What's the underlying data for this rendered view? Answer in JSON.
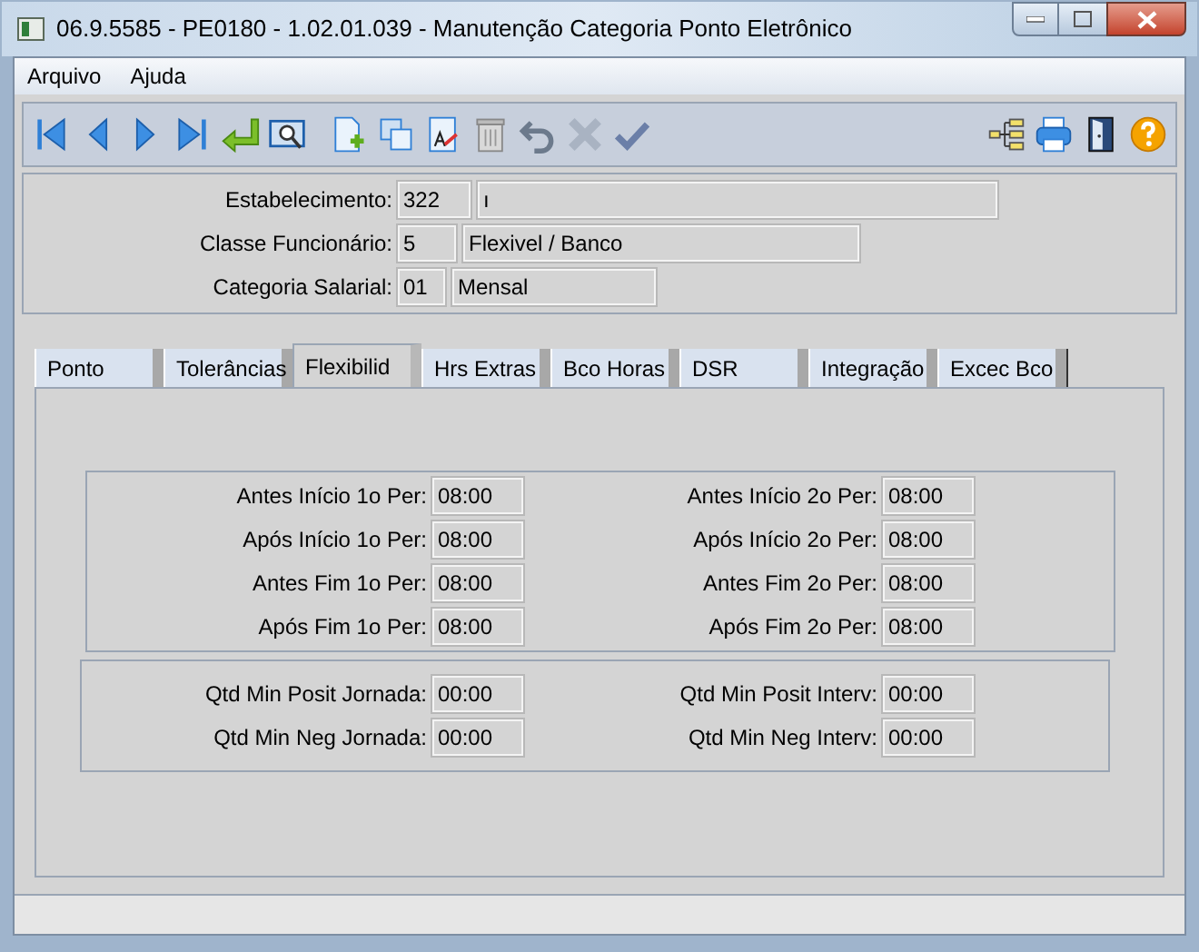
{
  "window": {
    "title": "06.9.5585 - PE0180 - 1.02.01.039 - Manutenção Categoria Ponto Eletrônico"
  },
  "menu": [
    "Arquivo",
    "Ajuda"
  ],
  "header": [
    {
      "label": "Estabelecimento:",
      "code": "322",
      "description": "ı"
    },
    {
      "label": "Classe Funcionário:",
      "code": "5",
      "description": "Flexivel / Banco"
    },
    {
      "label": "Categoria Salarial:",
      "code": "01",
      "description": "Mensal"
    }
  ],
  "tabs": [
    {
      "label": "Ponto",
      "selected": false
    },
    {
      "label": "Tolerâncias",
      "selected": false
    },
    {
      "label": "Flexibilid",
      "selected": true
    },
    {
      "label": "Hrs Extras",
      "selected": false
    },
    {
      "label": "Bco Horas",
      "selected": false
    },
    {
      "label": "DSR",
      "selected": false
    },
    {
      "label": "Integração",
      "selected": false
    },
    {
      "label": "Excec Bco",
      "selected": false
    }
  ],
  "groups": [
    {
      "rows": [
        {
          "left": {
            "label": "Antes Início 1o Per:",
            "value": "08:00"
          },
          "right": {
            "label": "Antes Início 2o Per:",
            "value": "08:00"
          }
        },
        {
          "left": {
            "label": "Após Início 1o Per:",
            "value": "08:00"
          },
          "right": {
            "label": "Após Início 2o Per:",
            "value": "08:00"
          }
        },
        {
          "left": {
            "label": "Antes Fim 1o Per:",
            "value": "08:00"
          },
          "right": {
            "label": "Antes Fim 2o Per:",
            "value": "08:00"
          }
        },
        {
          "left": {
            "label": "Após Fim 1o Per:",
            "value": "08:00"
          },
          "right": {
            "label": "Após Fim 2o Per:",
            "value": "08:00"
          }
        }
      ]
    },
    {
      "rows": [
        {
          "left": {
            "label": "Qtd Min Posit Jornada:",
            "value": "00:00"
          },
          "right": {
            "label": "Qtd Min Posit Interv:",
            "value": "00:00"
          }
        },
        {
          "left": {
            "label": "Qtd Min Neg Jornada:",
            "value": "00:00"
          },
          "right": {
            "label": "Qtd Min Neg Interv:",
            "value": "00:00"
          }
        }
      ]
    }
  ]
}
